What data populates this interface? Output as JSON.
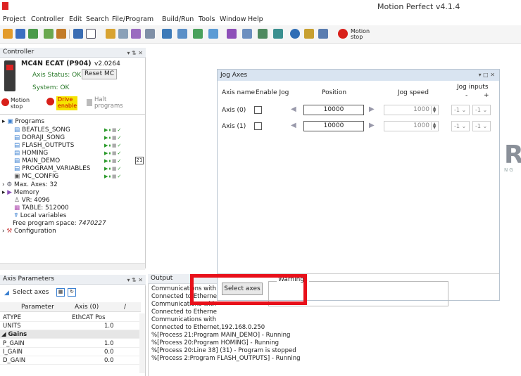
{
  "app": {
    "title": "Motion Perfect v4.1.4"
  },
  "menu": [
    "Project",
    "Controller",
    "Edit",
    "Search",
    "File/Program",
    "Build/Run",
    "Tools",
    "Window",
    "Help"
  ],
  "toolbar": {
    "motion_stop": "Motion stop"
  },
  "controller_panel": {
    "header": "Controller",
    "device": "MC4N ECAT (P904)",
    "version": "v2.0264",
    "axis_status": "Axis Status: OK",
    "reset_label": "Reset MC",
    "system": "System: OK",
    "motion_stop": "Motion stop",
    "drive_enable": "Drive enable",
    "halt_programs": "Halt programs",
    "programs_label": "Programs",
    "programs": [
      "BEATLES_SONG",
      "DORAJI_SONG",
      "FLASH_OUTPUTS",
      "HOMING",
      "MAIN_DEMO",
      "PROGRAM_VARIABLES",
      "MC_CONFIG"
    ],
    "main_demo_process": "21",
    "max_axes": "Max. Axes: 32",
    "memory": "Memory",
    "vr": "VR: 4096",
    "table": "TABLE: 512000",
    "local_vars": "Local variables",
    "free_space_label": "Free program space:",
    "free_space_value": "7470227",
    "configuration": "Configuration"
  },
  "axis_params": {
    "header": "Axis Parameters",
    "select_axes": "Select axes",
    "col_param": "Parameter",
    "col_axis": "Axis (0)",
    "rows": [
      {
        "p": "ATYPE",
        "v": "EthCAT Pos"
      },
      {
        "p": "UNITS",
        "v": "1.0"
      }
    ],
    "gains": "Gains",
    "gain_rows": [
      {
        "p": "P_GAIN",
        "v": "1.0"
      },
      {
        "p": "I_GAIN",
        "v": "0.0"
      },
      {
        "p": "D_GAIN",
        "v": "0.0"
      }
    ]
  },
  "jog": {
    "title": "Jog Axes",
    "col_axis": "Axis name",
    "col_enable": "Enable Jog",
    "col_position": "Position",
    "col_speed": "Jog speed",
    "col_inputs": "Jog inputs",
    "inputs_minus": "-",
    "inputs_plus": "+",
    "axes": [
      {
        "name": "Axis (0)",
        "position": "10000",
        "speed": "1000",
        "in1": "-1",
        "in2": "-1"
      },
      {
        "name": "Axis (1)",
        "position": "10000",
        "speed": "1000",
        "in1": "-1",
        "in2": "-1"
      }
    ],
    "select_axes": "Select axes",
    "warnings": "Warnings"
  },
  "output": {
    "header": "Output",
    "lines": [
      "Communications with",
      "Connected to Etherne",
      "Communications with",
      "Connected to Etherne",
      "Communications with",
      "Connected to Ethernet,192.168.0.250",
      "%[Process 21:Program MAIN_DEMO] - Running",
      "%[Process 20:Program HOMING] - Running",
      "%[Process 20:Line 38] (31) - Program is stopped",
      "%[Process 2:Program FLASH_OUTPUTS] - Running"
    ]
  },
  "colors": {
    "accent": "#e8101a",
    "motion_stop": "#d8201a",
    "drive_enable": "#f5e400"
  }
}
